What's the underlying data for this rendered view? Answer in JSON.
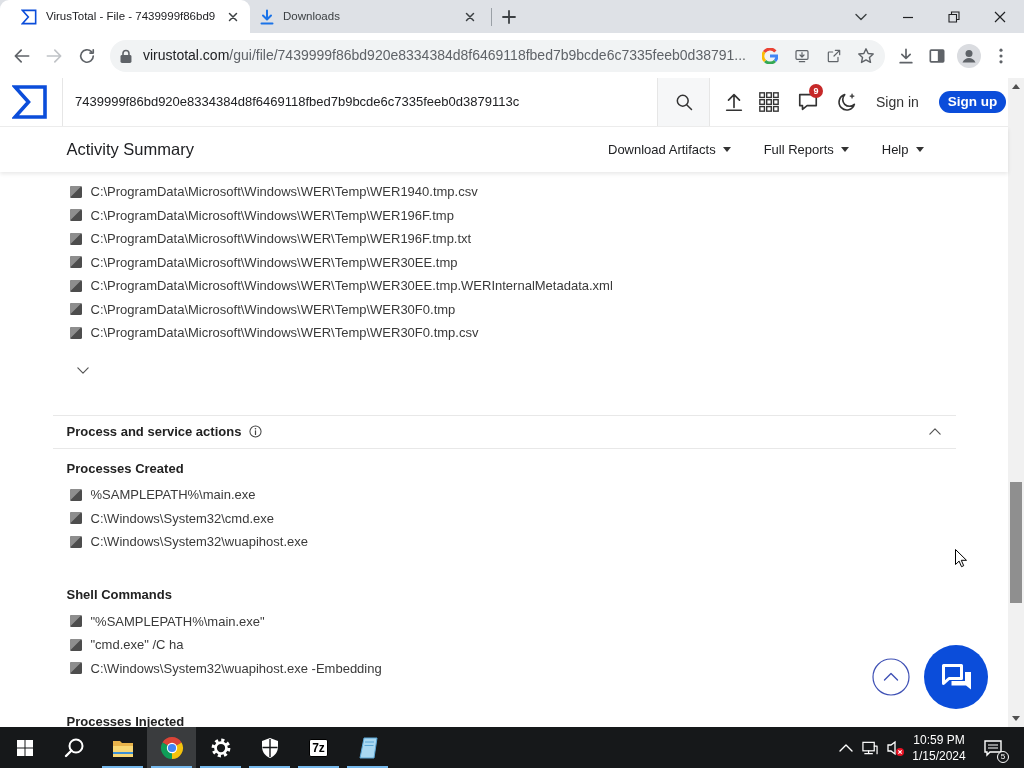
{
  "browser": {
    "tabs": [
      {
        "title": "VirusTotal - File - 7439999f86bd9",
        "kind": "site",
        "selected": true
      },
      {
        "title": "Downloads",
        "kind": "downloads",
        "selected": false
      }
    ],
    "navigation": {
      "forward_disabled": true
    },
    "address": {
      "host": "virustotal.com",
      "path": "/gui/file/7439999f86bd920e8334384d8f6469118fbed7b9bcde6c7335feeb0d38791..."
    }
  },
  "site_header": {
    "search_value": "7439999f86bd920e8334384d8f6469118fbed7b9bcde6c7335feeb0d3879113c",
    "notification_count": "9",
    "sign_in": "Sign in",
    "sign_up": "Sign up"
  },
  "section_bar": {
    "title": "Activity Summary",
    "menus": [
      "Download Artifacts",
      "Full Reports",
      "Help"
    ]
  },
  "file_list": {
    "items": [
      "C:\\ProgramData\\Microsoft\\Windows\\WER\\Temp\\WER1940.tmp.csv",
      "C:\\ProgramData\\Microsoft\\Windows\\WER\\Temp\\WER196F.tmp",
      "C:\\ProgramData\\Microsoft\\Windows\\WER\\Temp\\WER196F.tmp.txt",
      "C:\\ProgramData\\Microsoft\\Windows\\WER\\Temp\\WER30EE.tmp",
      "C:\\ProgramData\\Microsoft\\Windows\\WER\\Temp\\WER30EE.tmp.WERInternalMetadata.xml",
      "C:\\ProgramData\\Microsoft\\Windows\\WER\\Temp\\WER30F0.tmp",
      "C:\\ProgramData\\Microsoft\\Windows\\WER\\Temp\\WER30F0.tmp.csv"
    ]
  },
  "process_section": {
    "title": "Process and service actions",
    "expanded": true,
    "groups": [
      {
        "title": "Processes Created",
        "items": [
          "%SAMPLEPATH%\\main.exe",
          "C:\\Windows\\System32\\cmd.exe",
          "C:\\Windows\\System32\\wuapihost.exe"
        ]
      },
      {
        "title": "Shell Commands",
        "items": [
          "\"%SAMPLEPATH%\\main.exe\"",
          "\"cmd.exe\" /C ha",
          "C:\\Windows\\System32\\wuapihost.exe -Embedding"
        ]
      },
      {
        "title": "Processes Injected"
      }
    ]
  },
  "taskbar": {
    "apps": [
      {
        "kind": "folder",
        "running": true,
        "selected": false
      },
      {
        "kind": "browser",
        "running": true,
        "selected": true
      },
      {
        "kind": "gear",
        "running": true,
        "selected": false
      },
      {
        "kind": "shield",
        "running": true,
        "selected": false
      },
      {
        "kind": "archiver",
        "label": "7z",
        "running": true,
        "selected": false
      },
      {
        "kind": "note",
        "running": true,
        "selected": false
      }
    ],
    "time": "10:59 PM",
    "date": "1/15/2024",
    "notification_count": "5"
  }
}
